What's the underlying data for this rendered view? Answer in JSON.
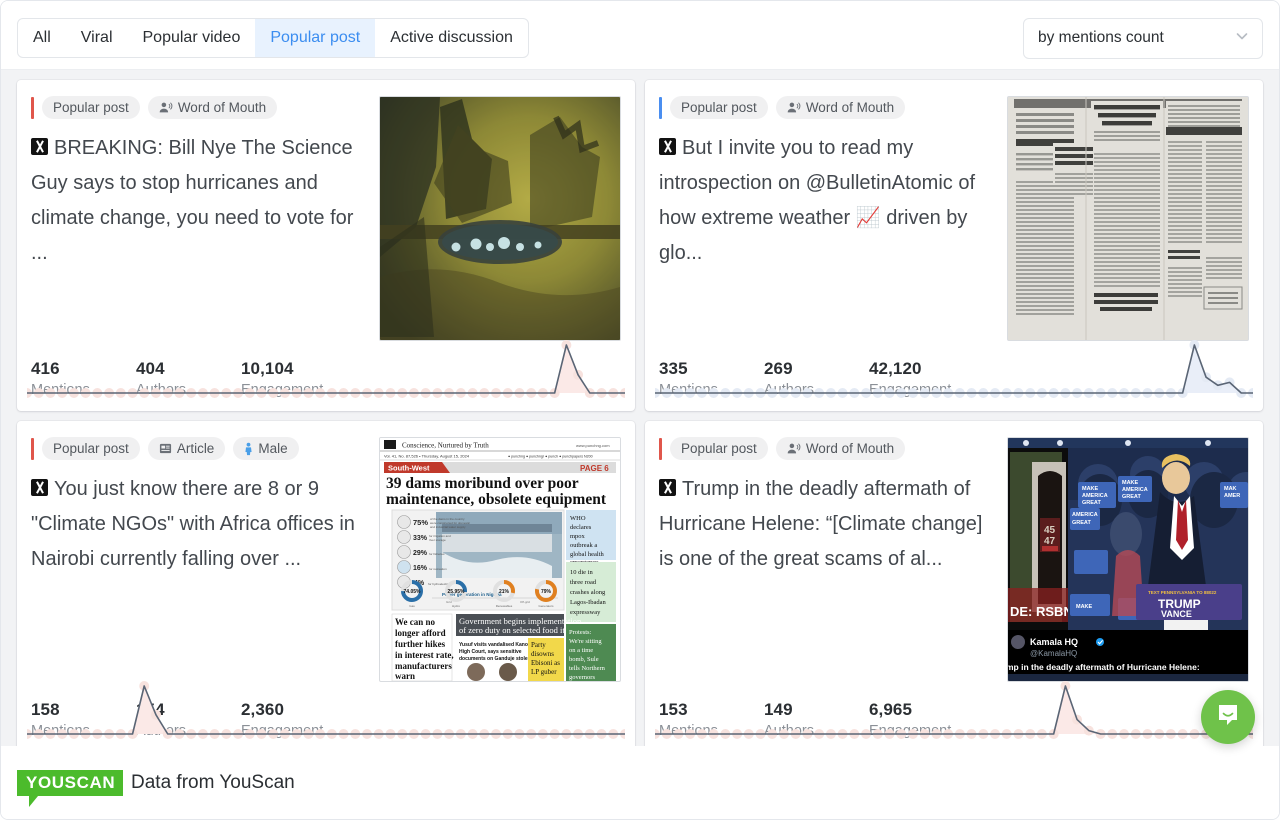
{
  "toolbar": {
    "tabs": [
      {
        "label": "All",
        "active": false
      },
      {
        "label": "Viral",
        "active": false
      },
      {
        "label": "Popular video",
        "active": false
      },
      {
        "label": "Popular post",
        "active": true
      },
      {
        "label": "Active discussion",
        "active": false
      }
    ],
    "sort_select": {
      "value": "by mentions count",
      "icon": "chevron-down-icon"
    },
    "active_tab_color": "#3b8df0",
    "active_tab_bg": "#e8f2fe"
  },
  "cards": [
    {
      "accent_color": "#e0564b",
      "chips": [
        {
          "label": "Popular post",
          "icon": null
        },
        {
          "label": "Word of Mouth",
          "icon": "word-of-mouth-icon"
        }
      ],
      "source_icon": "x-twitter-icon",
      "text": "BREAKING: Bill Nye The Science Guy says to stop hurricanes and climate change, you need to vote for ...",
      "metrics": [
        {
          "value": "416",
          "label": "Mentions"
        },
        {
          "value": "404",
          "label": "Authors"
        },
        {
          "value": "10,104",
          "label": "Engagement"
        }
      ],
      "thumbnail": "godzilla-king-ghidorah-scene",
      "spark": {
        "color": "#5a6575",
        "fill": "#fbe9e7",
        "dot_color": "#f7e2de",
        "points": [
          0,
          0,
          0,
          0,
          0,
          0,
          0,
          0,
          0,
          0,
          0,
          0,
          0,
          0,
          0,
          0,
          0,
          0,
          0,
          0,
          0,
          0,
          0,
          0,
          0,
          0,
          0,
          0,
          0,
          0,
          0,
          0,
          0,
          0,
          0,
          0,
          0,
          0,
          0,
          0,
          0,
          0,
          0,
          0,
          0,
          0,
          1,
          0.38,
          0,
          0,
          0,
          0
        ]
      }
    },
    {
      "accent_color": "#4a8ef0",
      "chips": [
        {
          "label": "Popular post",
          "icon": null
        },
        {
          "label": "Word of Mouth",
          "icon": "word-of-mouth-icon"
        }
      ],
      "source_icon": "x-twitter-icon",
      "text": "But I invite you to read my introspection on @BulletinAtomic of how extreme weather 📈 driven by glo...",
      "metrics": [
        {
          "value": "335",
          "label": "Mentions"
        },
        {
          "value": "269",
          "label": "Authors"
        },
        {
          "value": "42,120",
          "label": "Engagement"
        }
      ],
      "thumbnail": "old-newspaper-hurricane-scan",
      "spark": {
        "color": "#5a6575",
        "fill": "#e9eef8",
        "dot_color": "#e4eaf4",
        "points": [
          0,
          0,
          0,
          0,
          0,
          0,
          0,
          0,
          0,
          0,
          0,
          0,
          0,
          0,
          0,
          0,
          0,
          0,
          0,
          0,
          0,
          0,
          0,
          0,
          0,
          0,
          0,
          0,
          0,
          0,
          0,
          0,
          0,
          0,
          0,
          0,
          0,
          0,
          0,
          0,
          0,
          0,
          0,
          0,
          0,
          0,
          1,
          0.33,
          0.16,
          0.22,
          0,
          0
        ]
      }
    },
    {
      "accent_color": "#e0564b",
      "chips": [
        {
          "label": "Popular post",
          "icon": null
        },
        {
          "label": "Article",
          "icon": "article-icon"
        },
        {
          "label": "Male",
          "icon": "male-icon"
        }
      ],
      "source_icon": "x-twitter-icon",
      "text": "You just know there are 8 or 9 \"Climate NGOs\" with Africa offices in Nairobi currently falling over ...",
      "metrics": [
        {
          "value": "158",
          "label": "Mentions"
        },
        {
          "value": "154",
          "label": "Authors"
        },
        {
          "value": "2,360",
          "label": "Engagement"
        }
      ],
      "thumbnail": "nigerian-newspaper-front-page",
      "spark": {
        "color": "#5a6575",
        "fill": "#fbe9e7",
        "dot_color": "#f7e2de",
        "points": [
          0,
          0,
          0,
          0,
          0,
          0,
          0,
          0,
          0,
          0,
          1,
          0.4,
          0,
          0,
          0,
          0,
          0,
          0,
          0,
          0,
          0,
          0,
          0,
          0,
          0,
          0,
          0,
          0,
          0,
          0,
          0,
          0,
          0,
          0,
          0,
          0,
          0,
          0,
          0,
          0,
          0,
          0,
          0,
          0,
          0,
          0,
          0,
          0,
          0,
          0,
          0,
          0
        ]
      }
    },
    {
      "accent_color": "#e0564b",
      "chips": [
        {
          "label": "Popular post",
          "icon": null
        },
        {
          "label": "Word of Mouth",
          "icon": "word-of-mouth-icon"
        }
      ],
      "source_icon": "x-twitter-icon",
      "text": "Trump in the deadly aftermath of Hurricane Helene: “[Climate change] is one of the great scams of al...",
      "metrics": [
        {
          "value": "153",
          "label": "Mentions"
        },
        {
          "value": "149",
          "label": "Authors"
        },
        {
          "value": "6,965",
          "label": "Engagement"
        }
      ],
      "thumbnail": "trump-rally-kamala-hq-tweet",
      "spark": {
        "color": "#5a6575",
        "fill": "#fbe9e7",
        "dot_color": "#f7e2de",
        "points": [
          0,
          0,
          0,
          0,
          0,
          0,
          0,
          0,
          0,
          0,
          0,
          0,
          0,
          0,
          0,
          0,
          0,
          0,
          0,
          0,
          0,
          0,
          0,
          0,
          0,
          0,
          0,
          0,
          0,
          0,
          0,
          0,
          0,
          0,
          0,
          1,
          0.3,
          0.07,
          0,
          0,
          0,
          0,
          0,
          0,
          0,
          0,
          0,
          0,
          0,
          0,
          0,
          0
        ]
      }
    }
  ],
  "footer": {
    "logo_text": "YOUSCAN",
    "logo_color": "#4cbb2c",
    "caption": "Data from YouScan"
  },
  "chat_widget": {
    "icon": "chat-bubble-icon",
    "color": "#6fc24a"
  },
  "thumbnail_labels": {
    "card3_headline": "39 dams moribund over poor maintenance, obsolete equipment",
    "card3_kicker": "South-West",
    "card3_page": "PAGE 6",
    "card3_masthead": "Conscience, Nurtured by Truth",
    "card4_account_name": "Kamala HQ",
    "card4_account_handle": "@KamalaHQ",
    "card4_tweet": "mp in the deadly aftermath of Hurricane Helene: imate change] is one of the great scams of all time",
    "card4_sign": "TRUMP VANCE",
    "card4_overlay": "DE: RSBN",
    "card2_headline": "SEVERAL LIVES BELIEVED LOST IN HURRICANE"
  }
}
